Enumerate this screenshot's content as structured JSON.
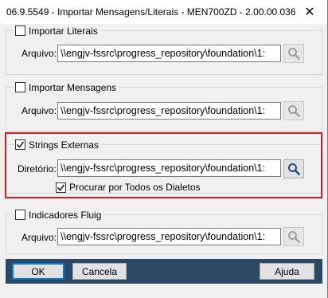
{
  "window": {
    "title": "06.9.5549 - Importar Mensagens/Literais - MEN700ZD - 2.00.00.036",
    "close_glyph": "✕"
  },
  "groups": {
    "literais": {
      "label": "Importar Literais",
      "checked": false,
      "field_label": "Arquivo:",
      "value": "\\\\engjv-fssrc\\progress_repository\\foundation\\1:"
    },
    "mensagens": {
      "label": "Importar Mensagens",
      "checked": false,
      "field_label": "Arquivo:",
      "value": "\\\\engjv-fssrc\\progress_repository\\foundation\\1:"
    },
    "strings": {
      "label": "Strings Externas",
      "checked": true,
      "field_label": "Diretório:",
      "value": "\\\\engjv-fssrc\\progress_repository\\foundation\\1:",
      "dialetos_label": "Procurar por Todos os Dialetos",
      "dialetos_checked": true
    },
    "fluig": {
      "label": "Indicadores Fluig",
      "checked": false,
      "field_label": "Arquivo:",
      "value": "\\\\engjv-fssrc\\progress_repository\\foundation\\1:"
    }
  },
  "footer": {
    "ok_label": "OK",
    "cancel_label": "Cancela",
    "help_label": "Ajuda"
  },
  "icons": {
    "search_enabled": "search-icon",
    "search_disabled": "search-icon-disabled"
  },
  "colors": {
    "highlight": "#d01f27",
    "footer_bar": "#2b4965",
    "default_button_border": "#0078d7"
  }
}
